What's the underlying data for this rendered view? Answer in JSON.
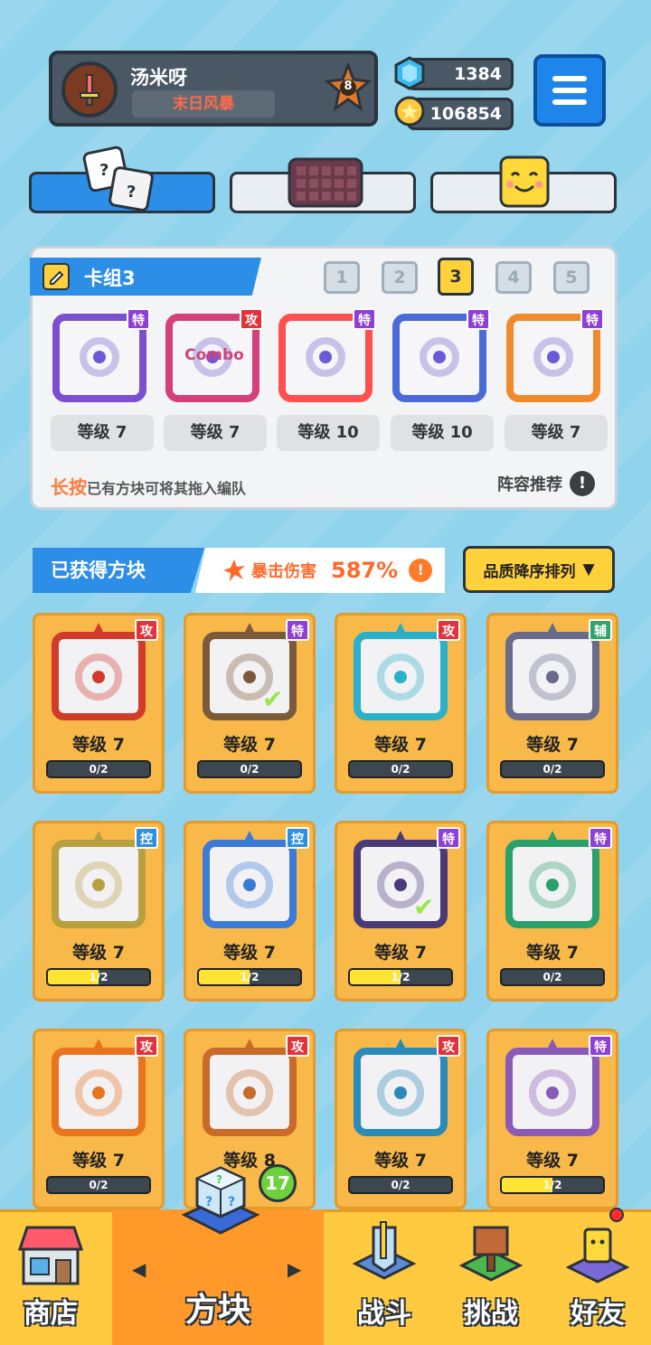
{
  "player": {
    "name": "汤米呀",
    "title": "末日风暴",
    "rank": "8"
  },
  "currency": {
    "gems": "1384",
    "coins": "106854"
  },
  "deck": {
    "title": "卡组3",
    "numbers": [
      "1",
      "2",
      "3",
      "4",
      "5"
    ],
    "active_index": 2,
    "cards": [
      {
        "tag": "特",
        "tag_color": "#8e3fd6",
        "frame": "#7b4fd0",
        "level": "等级 7"
      },
      {
        "tag": "攻",
        "tag_color": "#e2323a",
        "frame": "#d4407a",
        "level": "等级 7",
        "text": "Combo"
      },
      {
        "tag": "特",
        "tag_color": "#8e3fd6",
        "frame": "#ff4f4f",
        "level": "等级 10"
      },
      {
        "tag": "特",
        "tag_color": "#8e3fd6",
        "frame": "#4a6ad8",
        "level": "等级 10"
      },
      {
        "tag": "特",
        "tag_color": "#8e3fd6",
        "frame": "#f08a2a",
        "level": "等级 7"
      }
    ],
    "hint_highlight": "长按",
    "hint_text": "已有方块可将其拖入编队",
    "recommend": "阵容推荐"
  },
  "owned": {
    "title": "已获得方块",
    "crit_label": "暴击伤害",
    "crit_value": "587%",
    "sort_label": "品质降序排列"
  },
  "blocks": [
    {
      "tag": "攻",
      "tag_color": "#e2323a",
      "frame": "#d23a2a",
      "level": "等级 7",
      "progress": "0/2",
      "fill": 0
    },
    {
      "tag": "特",
      "tag_color": "#8e3fd6",
      "frame": "#7a5a3a",
      "level": "等级 7",
      "progress": "0/2",
      "fill": 0,
      "check": true
    },
    {
      "tag": "攻",
      "tag_color": "#e2323a",
      "frame": "#2ab0c8",
      "level": "等级 7",
      "progress": "0/2",
      "fill": 0
    },
    {
      "tag": "辅",
      "tag_color": "#2ea66a",
      "frame": "#6a6a8a",
      "level": "等级 7",
      "progress": "0/2",
      "fill": 0
    },
    {
      "tag": "控",
      "tag_color": "#2b8fe0",
      "frame": "#b8a040",
      "level": "等级 7",
      "progress": "1/2",
      "fill": 0.5
    },
    {
      "tag": "控",
      "tag_color": "#2b8fe0",
      "frame": "#3a7ad8",
      "level": "等级 7",
      "progress": "1/2",
      "fill": 0.5
    },
    {
      "tag": "特",
      "tag_color": "#8e3fd6",
      "frame": "#4a3a7a",
      "level": "等级 7",
      "progress": "1/2",
      "fill": 0.5,
      "check": true
    },
    {
      "tag": "特",
      "tag_color": "#8e3fd6",
      "frame": "#2aa06a",
      "level": "等级 7",
      "progress": "0/2",
      "fill": 0
    },
    {
      "tag": "攻",
      "tag_color": "#e2323a",
      "frame": "#e8741e",
      "level": "等级 7",
      "progress": "0/2",
      "fill": 0
    },
    {
      "tag": "攻",
      "tag_color": "#e2323a",
      "frame": "#c86a2a",
      "level": "等级 8",
      "progress": "",
      "fill": 0
    },
    {
      "tag": "攻",
      "tag_color": "#e2323a",
      "frame": "#2a8ab8",
      "level": "等级 7",
      "progress": "0/2",
      "fill": 0
    },
    {
      "tag": "特",
      "tag_color": "#8e3fd6",
      "frame": "#8a5ab8",
      "level": "等级 7",
      "progress": "1/2",
      "fill": 0.5
    }
  ],
  "nav": {
    "shop": "商店",
    "blocks": "方块",
    "battle": "战斗",
    "challenge": "挑战",
    "friends": "好友",
    "badge": "17"
  }
}
